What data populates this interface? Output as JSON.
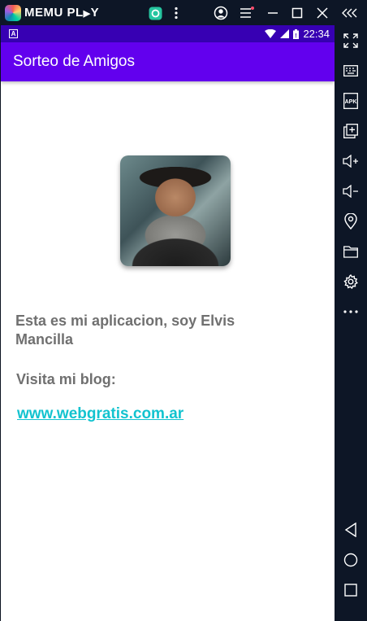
{
  "emulator": {
    "title_left": "MEMU PL",
    "title_right": "Y",
    "icons": [
      "memu-logo-icon",
      "app-store-icon",
      "kebab-menu-icon",
      "account-icon",
      "menu-icon",
      "minimize-icon",
      "maximize-icon",
      "close-icon",
      "collapse-panel-icon"
    ],
    "sidebar": [
      "fullscreen-icon",
      "keyboard-icon",
      "apk-icon",
      "multi-window-icon",
      "volume-up-icon",
      "volume-down-icon",
      "location-icon",
      "folder-icon",
      "settings-icon",
      "more-icon",
      "back-icon",
      "home-icon",
      "recents-icon"
    ],
    "sidebar_apk_label": "APK"
  },
  "status_bar": {
    "notification_badge": "A",
    "time": "22:34"
  },
  "app": {
    "title": "Sorteo de Amigos",
    "intro": "Esta es mi aplicacion, soy Elvis Mancilla",
    "blog_label": "Visita mi blog:",
    "blog_link": "www.webgratis.com.ar"
  },
  "colors": {
    "status_bar": "#3700b3",
    "app_bar": "#6200ee",
    "link": "#12c3cf",
    "body_text": "#707070",
    "emulator_chrome": "#0d1626"
  }
}
